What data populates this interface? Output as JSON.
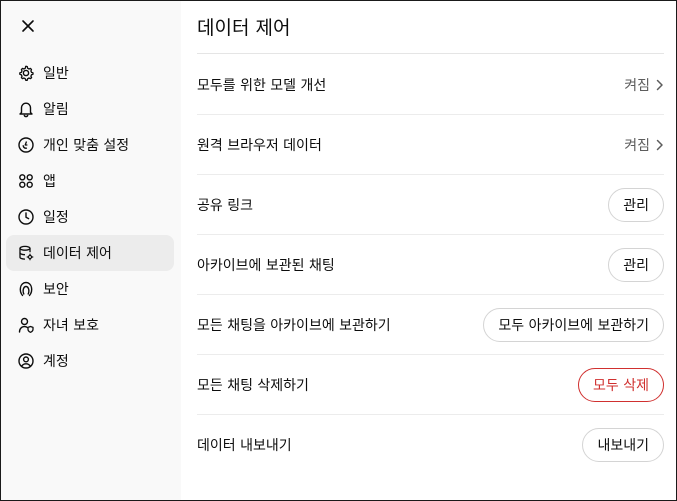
{
  "sidebar": {
    "items": [
      {
        "label": "일반",
        "icon": "gear-icon",
        "active": false
      },
      {
        "label": "알림",
        "icon": "bell-icon",
        "active": false
      },
      {
        "label": "개인 맞춤 설정",
        "icon": "personalization-icon",
        "active": false
      },
      {
        "label": "앱",
        "icon": "apps-grid-icon",
        "active": false
      },
      {
        "label": "일정",
        "icon": "clock-icon",
        "active": false
      },
      {
        "label": "데이터 제어",
        "icon": "database-gear-icon",
        "active": true
      },
      {
        "label": "보안",
        "icon": "security-icon",
        "active": false
      },
      {
        "label": "자녀 보호",
        "icon": "parental-controls-icon",
        "active": false
      },
      {
        "label": "계정",
        "icon": "account-icon",
        "active": false
      }
    ]
  },
  "main": {
    "title": "데이터 제어",
    "rows": [
      {
        "label": "모두를 위한 모델 개선",
        "value": "켜짐"
      },
      {
        "label": "원격 브라우저 데이터",
        "value": "켜짐"
      },
      {
        "label": "공유 링크",
        "button": "관리"
      },
      {
        "label": "아카이브에 보관된 채팅",
        "button": "관리"
      },
      {
        "label": "모든 채팅을 아카이브에 보관하기",
        "button": "모두 아카이브에 보관하기"
      },
      {
        "label": "모든 채팅 삭제하기",
        "button": "모두 삭제"
      },
      {
        "label": "데이터 내보내기",
        "button": "내보내기"
      }
    ]
  },
  "colors": {
    "danger": "#d0302f",
    "active_bg": "#ececec",
    "sidebar_bg": "#f9f9f9"
  }
}
